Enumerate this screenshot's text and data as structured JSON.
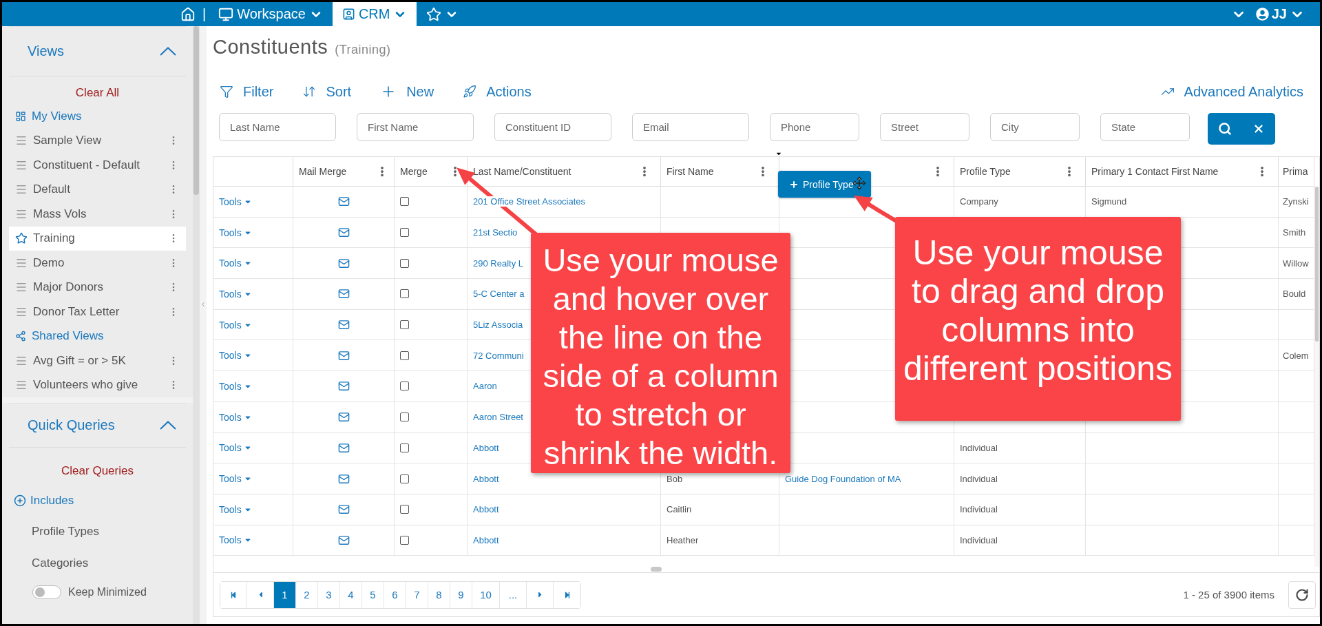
{
  "top_bar": {
    "separator": "|",
    "nav": [
      {
        "kind": "workspace",
        "label": "Workspace",
        "selected": false
      },
      {
        "kind": "crm",
        "label": "CRM",
        "selected": true
      },
      {
        "kind": "favorites",
        "selected": false
      }
    ],
    "user": "JJ"
  },
  "sidebar": {
    "sections": [
      {
        "title": "Views",
        "expanded": true,
        "action": "Clear All",
        "items": [
          {
            "kind": "mine",
            "label": "My Views"
          },
          {
            "kind": "view",
            "label": "Sample View",
            "selected": false
          },
          {
            "kind": "view",
            "label": "Constituent - Default",
            "selected": false
          },
          {
            "kind": "view",
            "label": "Default",
            "selected": false
          },
          {
            "kind": "view",
            "label": "Mass Vols",
            "selected": false
          },
          {
            "kind": "view",
            "label": "Training",
            "selected": true
          },
          {
            "kind": "view",
            "label": "Demo",
            "selected": false
          },
          {
            "kind": "view",
            "label": "Major Donors",
            "selected": false
          },
          {
            "kind": "view",
            "label": "Donor Tax Letter",
            "selected": false
          },
          {
            "kind": "shared",
            "label": "Shared Views"
          },
          {
            "kind": "view",
            "label": "Avg Gift = or > 5K",
            "selected": false
          },
          {
            "kind": "view",
            "label": "Volunteers who give",
            "selected": false
          }
        ]
      },
      {
        "title": "Quick Queries",
        "expanded": true,
        "action": "Clear Queries",
        "items": [
          {
            "kind": "include",
            "label": "Includes"
          },
          {
            "kind": "query",
            "label": "Profile Types"
          },
          {
            "kind": "query",
            "label": "Categories"
          }
        ]
      }
    ],
    "toggle": {
      "label": "Keep Minimized",
      "on": false
    }
  },
  "page": {
    "title": "Constituents",
    "subtitle": "(Training)"
  },
  "toolbar": [
    {
      "kind": "filter",
      "label": "Filter"
    },
    {
      "kind": "sort",
      "label": "Sort"
    },
    {
      "kind": "new",
      "label": "New"
    },
    {
      "kind": "actions",
      "label": "Actions"
    }
  ],
  "analytics": "Advanced Analytics",
  "filters": [
    {
      "placeholder": "Last Name"
    },
    {
      "placeholder": "First Name"
    },
    {
      "placeholder": "Constituent ID"
    },
    {
      "placeholder": "Email"
    },
    {
      "placeholder": "Phone"
    },
    {
      "placeholder": "Street"
    },
    {
      "placeholder": "City"
    },
    {
      "placeholder": "State"
    }
  ],
  "table": {
    "columns": [
      {
        "kind": "actions"
      },
      {
        "kind": "data",
        "label": "Mail Merge"
      },
      {
        "kind": "data",
        "label": "Merge"
      },
      {
        "kind": "data",
        "label": "Last Name/Constituent"
      },
      {
        "kind": "data",
        "label": "First Name"
      },
      {
        "kind": "data"
      },
      {
        "kind": "data",
        "label": "Profile Type"
      },
      {
        "kind": "data",
        "label": "Primary 1 Contact First Name"
      },
      {
        "kind": "partial",
        "label": "Prima"
      }
    ],
    "rows": [
      {
        "tools": "Tools",
        "merge_checked": false,
        "last_name": "201 Office Street Associates",
        "profile_type": "Company",
        "primary_1_contact_first_name": "Sigmund",
        "column_9": "Zynski"
      },
      {
        "tools": "Tools",
        "merge_checked": false,
        "last_name": "21st Sectio",
        "column_9": "Smith"
      },
      {
        "tools": "Tools",
        "merge_checked": false,
        "last_name": "290 Realty L",
        "column_9": "Willow"
      },
      {
        "tools": "Tools",
        "merge_checked": false,
        "last_name": "5-C Center a",
        "column_9": "Bould"
      },
      {
        "tools": "Tools",
        "merge_checked": false,
        "last_name": "5Liz Associa"
      },
      {
        "tools": "Tools",
        "merge_checked": false,
        "last_name": "72 Communi",
        "column_9": "Colem"
      },
      {
        "tools": "Tools",
        "merge_checked": false,
        "last_name": "Aaron"
      },
      {
        "tools": "Tools",
        "merge_checked": false,
        "last_name": "Aaron Street"
      },
      {
        "tools": "Tools",
        "merge_checked": false,
        "last_name": "Abbott",
        "profile_type": "Individual"
      },
      {
        "tools": "Tools",
        "merge_checked": false,
        "last_name": "Abbott",
        "first_name": "Bob",
        "column_6": "Guide Dog Foundation of MA",
        "profile_type": "Individual"
      },
      {
        "tools": "Tools",
        "merge_checked": false,
        "last_name": "Abbott",
        "first_name": "Caitlin",
        "profile_type": "Individual"
      },
      {
        "tools": "Tools",
        "merge_checked": false,
        "last_name": "Abbott",
        "first_name": "Heather",
        "profile_type": "Individual"
      }
    ]
  },
  "drag_chip": {
    "label": "Profile Type"
  },
  "pagination": {
    "pages": [
      {
        "label": "1",
        "selected": true
      },
      {
        "label": "2",
        "selected": false
      },
      {
        "label": "3",
        "selected": false
      },
      {
        "label": "4",
        "selected": false
      },
      {
        "label": "5",
        "selected": false
      },
      {
        "label": "6",
        "selected": false
      },
      {
        "label": "7",
        "selected": false
      },
      {
        "label": "8",
        "selected": false
      },
      {
        "label": "9",
        "selected": false
      },
      {
        "label": "10",
        "selected": false
      }
    ],
    "more": "...",
    "summary": "1 - 25 of 3900 items"
  },
  "callouts": [
    {
      "text": "Use your mouse and hover over the line on the side of a column to stretch or shrink the width."
    },
    {
      "text": "Use your mouse to drag and drop columns into different positions"
    }
  ]
}
